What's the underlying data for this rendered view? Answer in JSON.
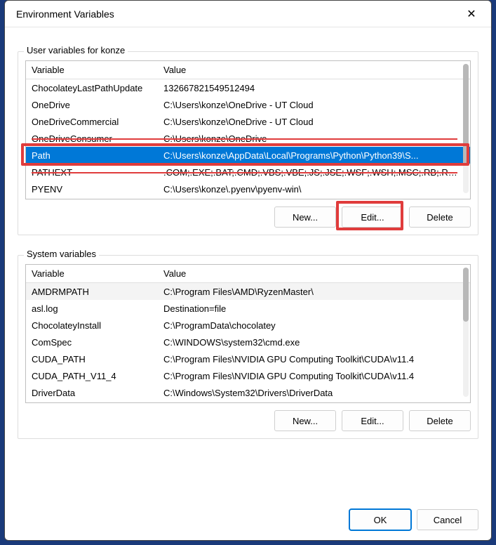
{
  "window": {
    "title": "Environment Variables"
  },
  "groups": {
    "user_legend": "User variables for konze",
    "system_legend": "System variables"
  },
  "headers": {
    "variable": "Variable",
    "value": "Value"
  },
  "user_vars": [
    {
      "name": "ChocolateyLastPathUpdate",
      "value": "132667821549512494",
      "strike": false,
      "selected": false
    },
    {
      "name": "OneDrive",
      "value": "C:\\Users\\konze\\OneDrive - UT Cloud",
      "strike": false,
      "selected": false
    },
    {
      "name": "OneDriveCommercial",
      "value": "C:\\Users\\konze\\OneDrive - UT Cloud",
      "strike": false,
      "selected": false
    },
    {
      "name": "OneDriveConsumer",
      "value": "C:\\Users\\konze\\OneDrive",
      "strike": true,
      "selected": false
    },
    {
      "name": "Path",
      "value": "C:\\Users\\konze\\AppData\\Local\\Programs\\Python\\Python39\\S...",
      "strike": false,
      "selected": true
    },
    {
      "name": "PATHEXT",
      "value": ".COM;.EXE;.BAT;.CMD;.VBS;.VBE;.JS;.JSE;.WSF;.WSH;.MSC;.RB;.RB...",
      "strike": true,
      "selected": false
    },
    {
      "name": "PYENV",
      "value": "C:\\Users\\konze\\.pyenv\\pyenv-win\\",
      "strike": false,
      "selected": false
    }
  ],
  "system_vars": [
    {
      "name": "AMDRMPATH",
      "value": "C:\\Program Files\\AMD\\RyzenMaster\\"
    },
    {
      "name": "asl.log",
      "value": "Destination=file"
    },
    {
      "name": "ChocolateyInstall",
      "value": "C:\\ProgramData\\chocolatey"
    },
    {
      "name": "ComSpec",
      "value": "C:\\WINDOWS\\system32\\cmd.exe"
    },
    {
      "name": "CUDA_PATH",
      "value": "C:\\Program Files\\NVIDIA GPU Computing Toolkit\\CUDA\\v11.4"
    },
    {
      "name": "CUDA_PATH_V11_4",
      "value": "C:\\Program Files\\NVIDIA GPU Computing Toolkit\\CUDA\\v11.4"
    },
    {
      "name": "DriverData",
      "value": "C:\\Windows\\System32\\Drivers\\DriverData"
    }
  ],
  "buttons": {
    "new": "New...",
    "edit": "Edit...",
    "delete": "Delete",
    "ok": "OK",
    "cancel": "Cancel"
  },
  "scroll": {
    "user_thumb_pct": 78,
    "system_thumb_pct": 42
  }
}
